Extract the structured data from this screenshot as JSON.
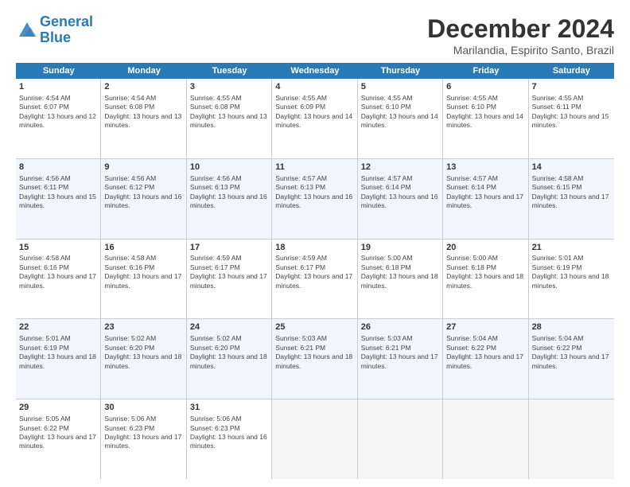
{
  "logo": {
    "line1": "General",
    "line2": "Blue"
  },
  "title": "December 2024",
  "location": "Marilandia, Espirito Santo, Brazil",
  "days_of_week": [
    "Sunday",
    "Monday",
    "Tuesday",
    "Wednesday",
    "Thursday",
    "Friday",
    "Saturday"
  ],
  "weeks": [
    [
      {
        "day": "1",
        "sunrise": "Sunrise: 4:54 AM",
        "sunset": "Sunset: 6:07 PM",
        "daylight": "Daylight: 13 hours and 12 minutes."
      },
      {
        "day": "2",
        "sunrise": "Sunrise: 4:54 AM",
        "sunset": "Sunset: 6:08 PM",
        "daylight": "Daylight: 13 hours and 13 minutes."
      },
      {
        "day": "3",
        "sunrise": "Sunrise: 4:55 AM",
        "sunset": "Sunset: 6:08 PM",
        "daylight": "Daylight: 13 hours and 13 minutes."
      },
      {
        "day": "4",
        "sunrise": "Sunrise: 4:55 AM",
        "sunset": "Sunset: 6:09 PM",
        "daylight": "Daylight: 13 hours and 14 minutes."
      },
      {
        "day": "5",
        "sunrise": "Sunrise: 4:55 AM",
        "sunset": "Sunset: 6:10 PM",
        "daylight": "Daylight: 13 hours and 14 minutes."
      },
      {
        "day": "6",
        "sunrise": "Sunrise: 4:55 AM",
        "sunset": "Sunset: 6:10 PM",
        "daylight": "Daylight: 13 hours and 14 minutes."
      },
      {
        "day": "7",
        "sunrise": "Sunrise: 4:55 AM",
        "sunset": "Sunset: 6:11 PM",
        "daylight": "Daylight: 13 hours and 15 minutes."
      }
    ],
    [
      {
        "day": "8",
        "sunrise": "Sunrise: 4:56 AM",
        "sunset": "Sunset: 6:11 PM",
        "daylight": "Daylight: 13 hours and 15 minutes."
      },
      {
        "day": "9",
        "sunrise": "Sunrise: 4:56 AM",
        "sunset": "Sunset: 6:12 PM",
        "daylight": "Daylight: 13 hours and 16 minutes."
      },
      {
        "day": "10",
        "sunrise": "Sunrise: 4:56 AM",
        "sunset": "Sunset: 6:13 PM",
        "daylight": "Daylight: 13 hours and 16 minutes."
      },
      {
        "day": "11",
        "sunrise": "Sunrise: 4:57 AM",
        "sunset": "Sunset: 6:13 PM",
        "daylight": "Daylight: 13 hours and 16 minutes."
      },
      {
        "day": "12",
        "sunrise": "Sunrise: 4:57 AM",
        "sunset": "Sunset: 6:14 PM",
        "daylight": "Daylight: 13 hours and 16 minutes."
      },
      {
        "day": "13",
        "sunrise": "Sunrise: 4:57 AM",
        "sunset": "Sunset: 6:14 PM",
        "daylight": "Daylight: 13 hours and 17 minutes."
      },
      {
        "day": "14",
        "sunrise": "Sunrise: 4:58 AM",
        "sunset": "Sunset: 6:15 PM",
        "daylight": "Daylight: 13 hours and 17 minutes."
      }
    ],
    [
      {
        "day": "15",
        "sunrise": "Sunrise: 4:58 AM",
        "sunset": "Sunset: 6:16 PM",
        "daylight": "Daylight: 13 hours and 17 minutes."
      },
      {
        "day": "16",
        "sunrise": "Sunrise: 4:58 AM",
        "sunset": "Sunset: 6:16 PM",
        "daylight": "Daylight: 13 hours and 17 minutes."
      },
      {
        "day": "17",
        "sunrise": "Sunrise: 4:59 AM",
        "sunset": "Sunset: 6:17 PM",
        "daylight": "Daylight: 13 hours and 17 minutes."
      },
      {
        "day": "18",
        "sunrise": "Sunrise: 4:59 AM",
        "sunset": "Sunset: 6:17 PM",
        "daylight": "Daylight: 13 hours and 17 minutes."
      },
      {
        "day": "19",
        "sunrise": "Sunrise: 5:00 AM",
        "sunset": "Sunset: 6:18 PM",
        "daylight": "Daylight: 13 hours and 18 minutes."
      },
      {
        "day": "20",
        "sunrise": "Sunrise: 5:00 AM",
        "sunset": "Sunset: 6:18 PM",
        "daylight": "Daylight: 13 hours and 18 minutes."
      },
      {
        "day": "21",
        "sunrise": "Sunrise: 5:01 AM",
        "sunset": "Sunset: 6:19 PM",
        "daylight": "Daylight: 13 hours and 18 minutes."
      }
    ],
    [
      {
        "day": "22",
        "sunrise": "Sunrise: 5:01 AM",
        "sunset": "Sunset: 6:19 PM",
        "daylight": "Daylight: 13 hours and 18 minutes."
      },
      {
        "day": "23",
        "sunrise": "Sunrise: 5:02 AM",
        "sunset": "Sunset: 6:20 PM",
        "daylight": "Daylight: 13 hours and 18 minutes."
      },
      {
        "day": "24",
        "sunrise": "Sunrise: 5:02 AM",
        "sunset": "Sunset: 6:20 PM",
        "daylight": "Daylight: 13 hours and 18 minutes."
      },
      {
        "day": "25",
        "sunrise": "Sunrise: 5:03 AM",
        "sunset": "Sunset: 6:21 PM",
        "daylight": "Daylight: 13 hours and 18 minutes."
      },
      {
        "day": "26",
        "sunrise": "Sunrise: 5:03 AM",
        "sunset": "Sunset: 6:21 PM",
        "daylight": "Daylight: 13 hours and 17 minutes."
      },
      {
        "day": "27",
        "sunrise": "Sunrise: 5:04 AM",
        "sunset": "Sunset: 6:22 PM",
        "daylight": "Daylight: 13 hours and 17 minutes."
      },
      {
        "day": "28",
        "sunrise": "Sunrise: 5:04 AM",
        "sunset": "Sunset: 6:22 PM",
        "daylight": "Daylight: 13 hours and 17 minutes."
      }
    ],
    [
      {
        "day": "29",
        "sunrise": "Sunrise: 5:05 AM",
        "sunset": "Sunset: 6:22 PM",
        "daylight": "Daylight: 13 hours and 17 minutes."
      },
      {
        "day": "30",
        "sunrise": "Sunrise: 5:06 AM",
        "sunset": "Sunset: 6:23 PM",
        "daylight": "Daylight: 13 hours and 17 minutes."
      },
      {
        "day": "31",
        "sunrise": "Sunrise: 5:06 AM",
        "sunset": "Sunset: 6:23 PM",
        "daylight": "Daylight: 13 hours and 16 minutes."
      },
      null,
      null,
      null,
      null
    ]
  ]
}
